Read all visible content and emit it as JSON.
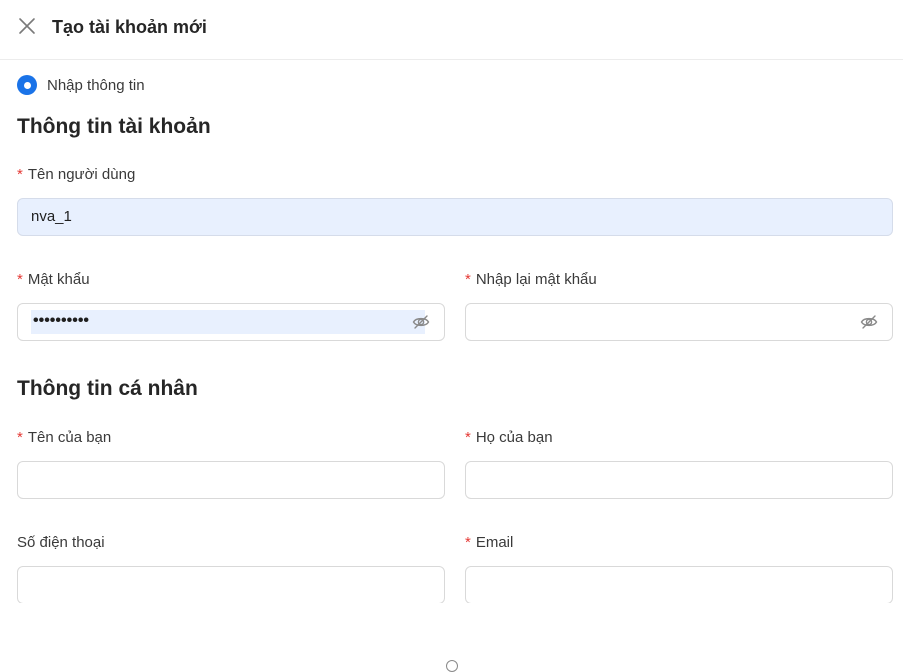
{
  "header": {
    "title": "Tạo tài khoản mới",
    "close_icon": "close-icon"
  },
  "steps": [
    {
      "label": "Nhập thông tin",
      "active": true
    }
  ],
  "account_section": {
    "title": "Thông tin tài khoản",
    "username": {
      "label": "Tên người dùng",
      "required": "*",
      "value": "nva_1"
    },
    "password": {
      "label": "Mật khẩu",
      "required": "*",
      "masked_value": "••••••••••",
      "icon": "eye-off-icon"
    },
    "confirm_password": {
      "label": "Nhập lại mật khẩu",
      "required": "*",
      "value": "",
      "icon": "eye-off-icon"
    }
  },
  "personal_section": {
    "title": "Thông tin cá nhân",
    "first_name": {
      "label": "Tên của bạn",
      "required": "*",
      "value": ""
    },
    "last_name": {
      "label": "Họ của bạn",
      "required": "*",
      "value": ""
    },
    "phone": {
      "label": "Số điện thoại",
      "value": ""
    },
    "email": {
      "label": "Email",
      "required": "*",
      "value": ""
    }
  },
  "colors": {
    "accent": "#1a73e8",
    "required": "#e53935",
    "autofill": "#e8f0fe",
    "border": "#d9d9d9"
  }
}
